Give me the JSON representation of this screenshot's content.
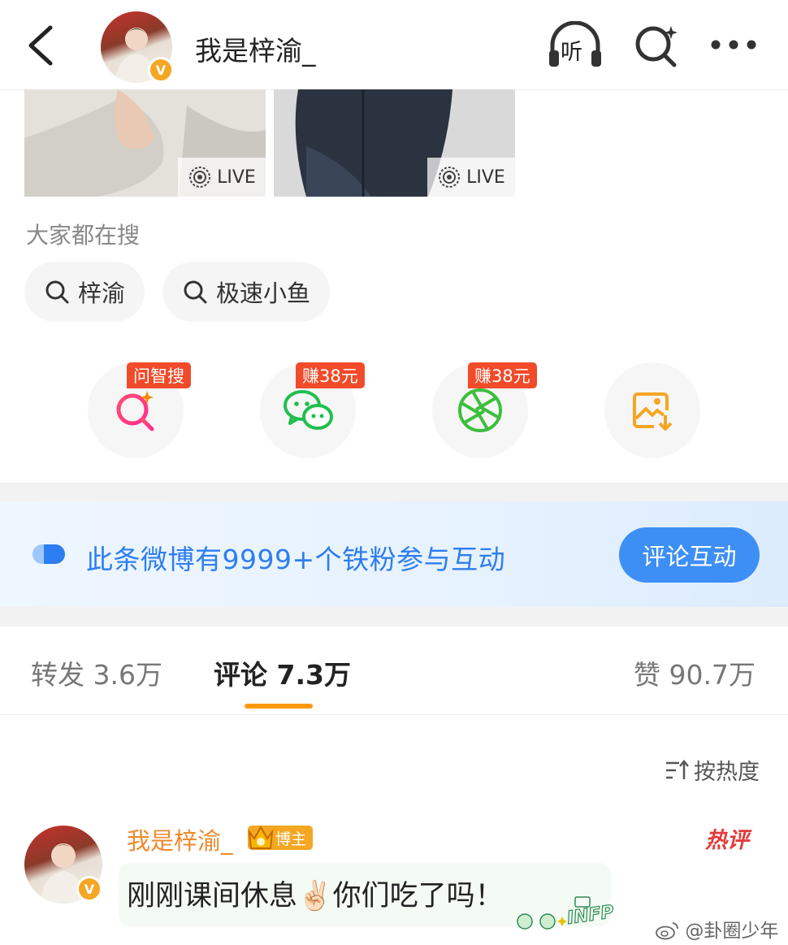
{
  "header": {
    "title": "我是梓渝_",
    "listen_label": "听"
  },
  "photos": [
    {
      "live_label": "LIVE"
    },
    {
      "live_label": "LIVE"
    }
  ],
  "search": {
    "title": "大家都在搜",
    "chips": [
      "梓渝",
      "极速小鱼"
    ]
  },
  "share": {
    "tags": [
      "问智搜",
      "赚38元",
      "赚38元"
    ]
  },
  "banner": {
    "text": "此条微博有9999+个铁粉参与互动",
    "button": "评论互动"
  },
  "tabs": {
    "repost": "转发 3.6万",
    "comment": "评论 7.3万",
    "like": "赞 90.7万"
  },
  "sort": {
    "label": "按热度"
  },
  "comment": {
    "name": "我是梓渝_",
    "badge": "博主",
    "text": "刚刚课间休息✌🏻你们吃了吗！",
    "hot_label": "热评",
    "sticker_text": "INFP"
  },
  "watermark": "@卦圈少年",
  "colors": {
    "accent_orange": "#ff9a0a",
    "link_blue": "#2d7ef0",
    "tag_red": "#f14b2a"
  }
}
